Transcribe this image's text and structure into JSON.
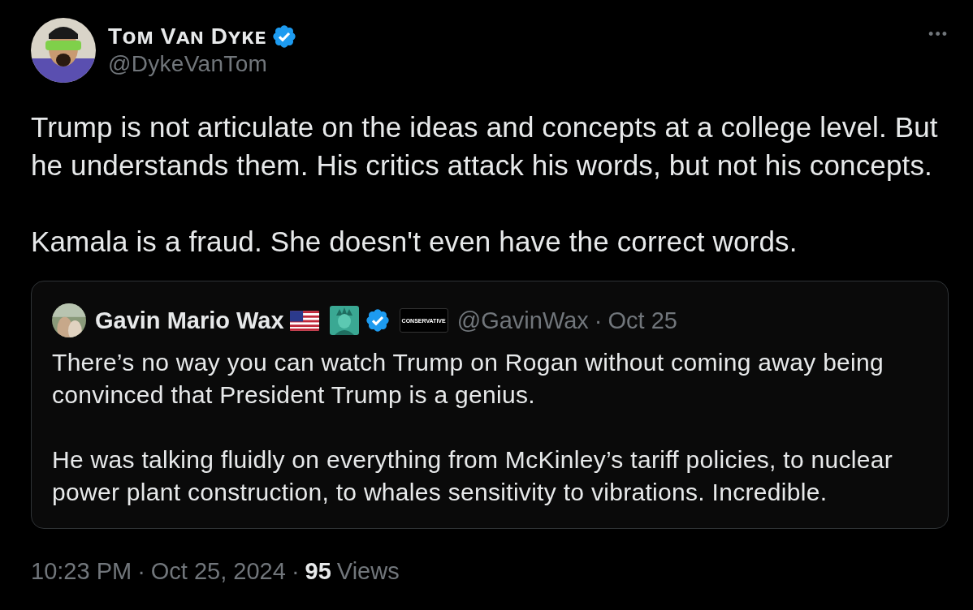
{
  "author": {
    "name": "Tᴏᴍ Vᴀɴ Dʏᴋᴇ",
    "handle": "@DykeVanTom",
    "verified": true
  },
  "more_button": "•••",
  "paragraphs": [
    "Trump is not articulate on the ideas and concepts at a college level. But he understands them. His critics attack his words, but not his concepts.",
    "Kamala is a fraud. She doesn't even have the correct words."
  ],
  "quote": {
    "name": "Gavin Mario Wax",
    "verified": true,
    "affiliate_badge": "CONSERVATIVE",
    "handle": "@GavinWax",
    "separator": "·",
    "date": "Oct 25",
    "paragraphs": [
      "There’s no way you can watch Trump on Rogan without coming away being convinced that President Trump is a genius.",
      "He was talking fluidly on everything from McKinley’s tariff policies, to nuclear power plant construction, to whales sensitivity to vibrations. Incredible."
    ]
  },
  "footer": {
    "time": "10:23 PM",
    "separator_1": "·",
    "date": "Oct 25, 2024",
    "separator_2": "·",
    "views_count": "95",
    "views_label": "Views"
  }
}
